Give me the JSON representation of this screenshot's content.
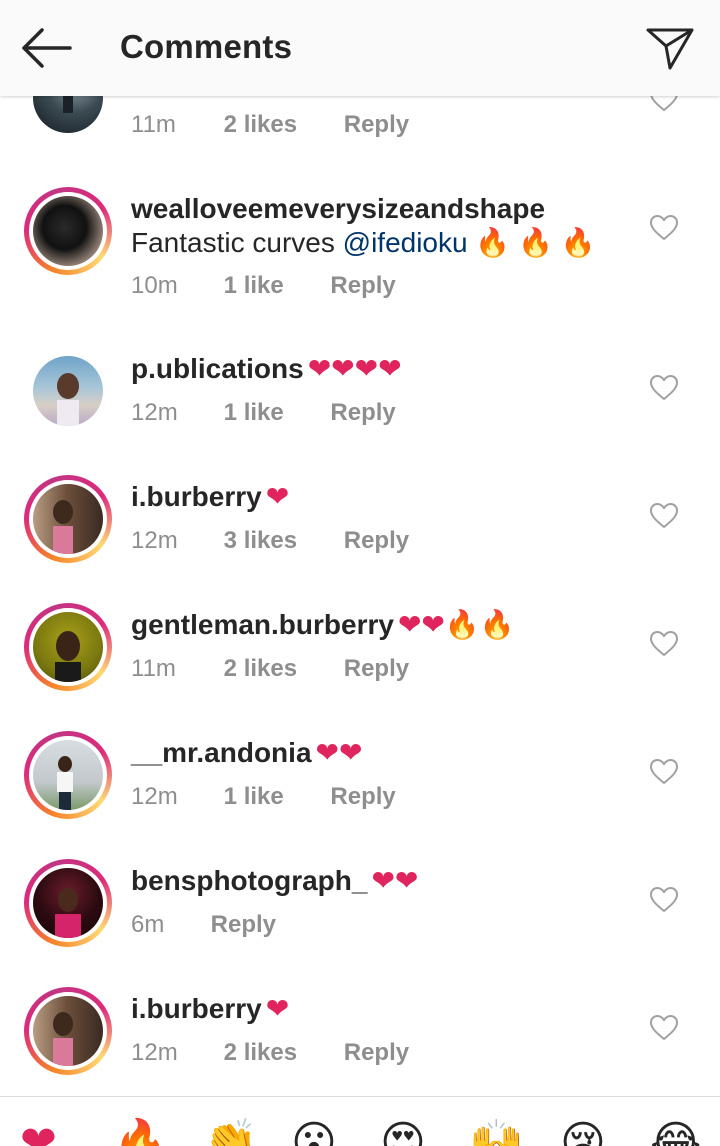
{
  "header": {
    "title": "Comments"
  },
  "comments": [
    {
      "username": "",
      "emoji": "",
      "text": "",
      "mention": "",
      "text_emoji": "",
      "time": "11m",
      "likes": "2 likes",
      "reply": "Reply"
    },
    {
      "username": "wealloveemeverysizeandshape",
      "emoji": "",
      "text": "Fantastic curves ",
      "mention": "@ifedioku",
      "text_emoji": " 🔥 🔥 🔥",
      "time": "10m",
      "likes": "1 like",
      "reply": "Reply"
    },
    {
      "username": "p.ublications",
      "emoji": "❤❤❤❤",
      "time": "12m",
      "likes": "1 like",
      "reply": "Reply"
    },
    {
      "username": "i.burberry",
      "emoji": "❤",
      "time": "12m",
      "likes": "3 likes",
      "reply": "Reply"
    },
    {
      "username": "gentleman.burberry",
      "emoji": "❤❤🔥🔥",
      "time": "11m",
      "likes": "2 likes",
      "reply": "Reply"
    },
    {
      "username": "__mr.andonia",
      "emoji": "❤❤",
      "time": "12m",
      "likes": "1 like",
      "reply": "Reply"
    },
    {
      "username": "bensphotograph_",
      "emoji": "❤❤",
      "time": "6m",
      "likes": "",
      "reply": "Reply"
    },
    {
      "username": "i.burberry",
      "emoji": "❤",
      "time": "12m",
      "likes": "2 likes",
      "reply": "Reply"
    }
  ],
  "emoji_bar": [
    "❤",
    "🔥",
    "👏",
    "😮",
    "😍",
    "🙌",
    "😢",
    "😂"
  ],
  "colors": {
    "mention": "#003569",
    "heart": "#e0245e",
    "meta": "#8e8e8e"
  }
}
